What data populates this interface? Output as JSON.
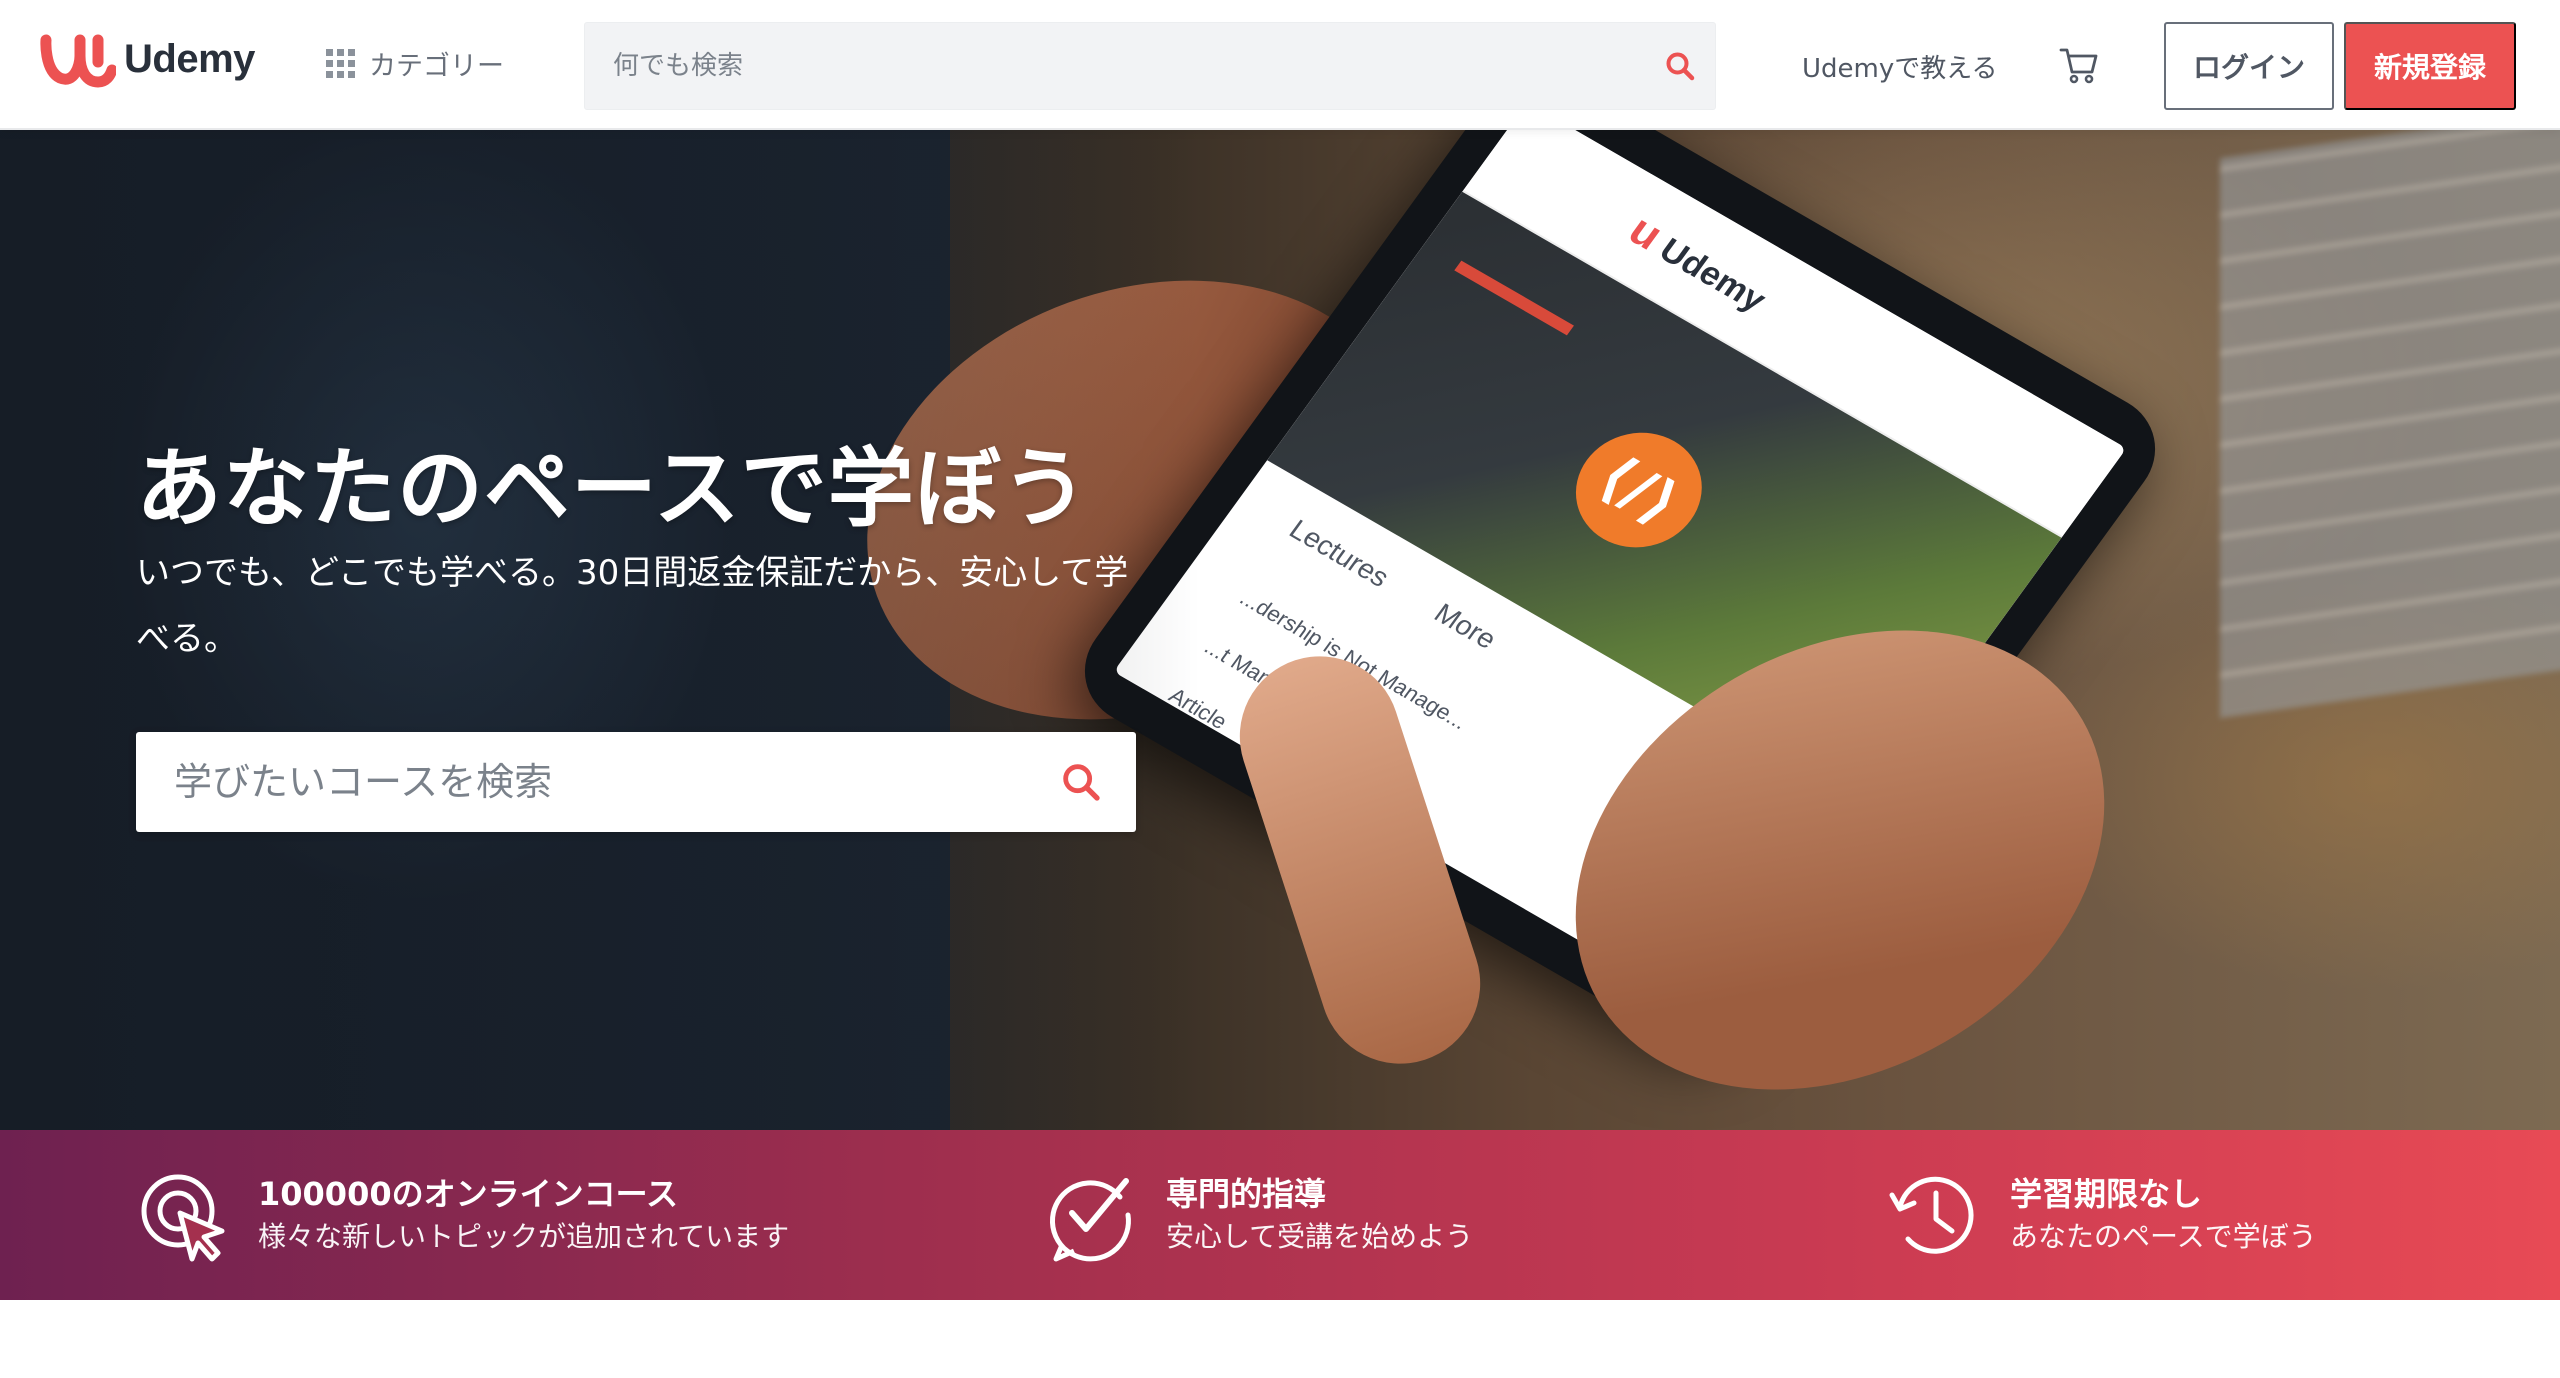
{
  "header": {
    "brand": "Udemy",
    "categories_label": "カテゴリー",
    "search_placeholder": "何でも検索",
    "teach_label": "Udemyで教える",
    "login_label": "ログイン",
    "signup_label": "新規登録"
  },
  "hero": {
    "title": "あなたのペースで学ぼう",
    "subtitle": "いつでも、どこでも学べる。30日間返金保証だから、安心して学べる。",
    "search_placeholder": "学びたいコースを検索",
    "phone": {
      "brand": "Udemy",
      "tab_lectures": "Lectures",
      "tab_more": "More",
      "list_items": [
        "...dership is Not Manage...",
        "...t Manag...",
        "Article"
      ]
    }
  },
  "features": [
    {
      "title": "100000のオンラインコース",
      "desc": "様々な新しいトピックが追加されています",
      "icon": "cursor-click-icon"
    },
    {
      "title": "専門的指導",
      "desc": "安心して受講を始めよう",
      "icon": "check-badge-icon"
    },
    {
      "title": "学習期限なし",
      "desc": "あなたのペースで学ぼう",
      "icon": "history-clock-icon"
    }
  ],
  "colors": {
    "brand_red": "#ec5252",
    "text_dark": "#29303b",
    "band_start": "#6e2150",
    "band_end": "#e84a55"
  }
}
